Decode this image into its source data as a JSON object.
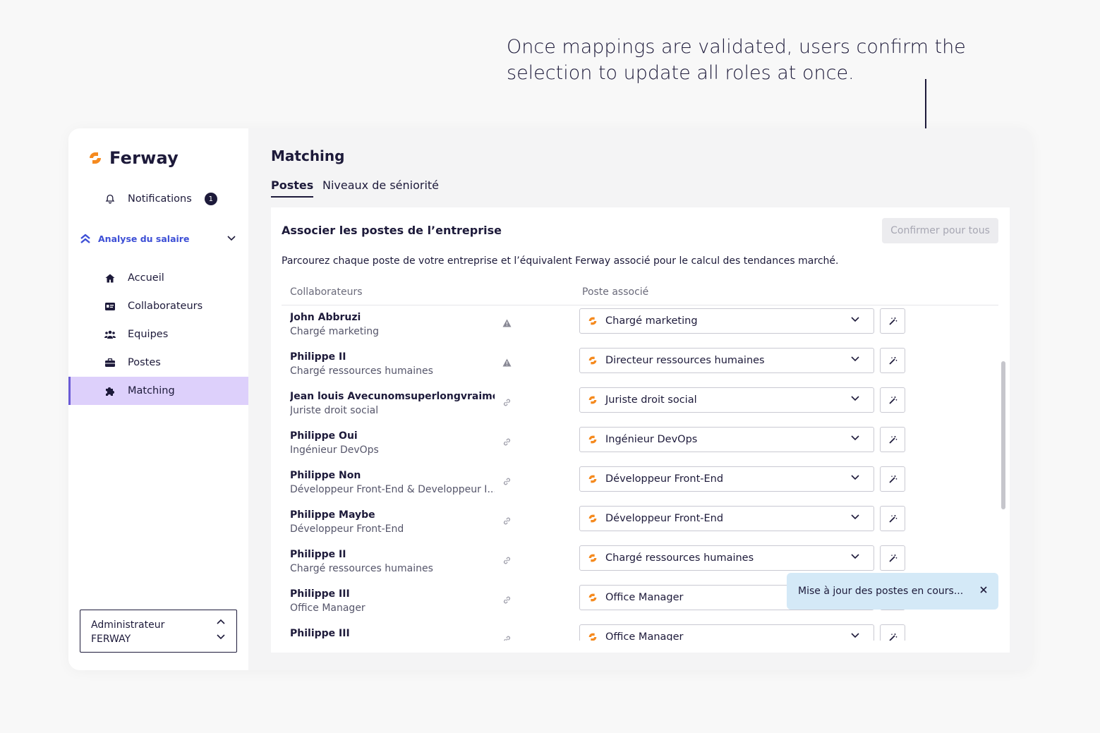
{
  "annotation": {
    "line1": "Once mappings are validated, users confirm the",
    "line2": "selection to update all roles at once."
  },
  "sidebar": {
    "brand": "Ferway",
    "notifications": {
      "label": "Notifications",
      "count": "1"
    },
    "section": {
      "label": "Analyse du salaire"
    },
    "items": [
      {
        "label": "Accueil",
        "icon": "home-icon"
      },
      {
        "label": "Collaborateurs",
        "icon": "id-card-icon"
      },
      {
        "label": "Equipes",
        "icon": "users-icon"
      },
      {
        "label": "Postes",
        "icon": "briefcase-icon"
      },
      {
        "label": "Matching",
        "icon": "puzzle-icon"
      }
    ],
    "account": {
      "line1": "Administrateur",
      "line2": "FERWAY"
    }
  },
  "main": {
    "title": "Matching",
    "tabs": [
      {
        "label": "Postes",
        "active": true
      },
      {
        "label": "Niveaux de séniorité",
        "active": false
      }
    ]
  },
  "card": {
    "title": "Associer les postes de l’entreprise",
    "confirm_label": "Confirmer pour tous",
    "description": "Parcourez chaque poste de votre entreprise et l’équivalent Ferway associé pour le calcul des tendances marché.",
    "col_collab": "Collaborateurs",
    "col_poste": "Poste associé",
    "rows": [
      {
        "name": "John Abbruzi",
        "role": "Chargé marketing",
        "status": "warning",
        "poste": "Chargé marketing"
      },
      {
        "name": "Philippe II",
        "role": "Chargé ressources humaines",
        "status": "warning",
        "poste": "Directeur ressources humaines"
      },
      {
        "name": "Jean louis Avecunomsuperlongvraime...",
        "role": "Juriste droit social",
        "status": "linked",
        "poste": "Juriste droit social"
      },
      {
        "name": "Philippe Oui",
        "role": "Ingénieur DevOps",
        "status": "linked",
        "poste": "Ingénieur DevOps"
      },
      {
        "name": "Philippe Non",
        "role": "Développeur Front-End & Developpeur I...",
        "status": "linked",
        "poste": "Développeur Front-End"
      },
      {
        "name": "Philippe Maybe",
        "role": "Développeur Front-End",
        "status": "linked",
        "poste": "Développeur Front-End"
      },
      {
        "name": "Philippe II",
        "role": "Chargé ressources humaines",
        "status": "linked",
        "poste": "Chargé ressources humaines"
      },
      {
        "name": "Philippe III",
        "role": "Office Manager",
        "status": "linked",
        "poste": "Office Manager"
      },
      {
        "name": "Philippe III",
        "role": "",
        "status": "linked",
        "poste": "Office Manager"
      }
    ]
  },
  "toast": {
    "message": "Mise à jour des postes en cours..."
  },
  "colors": {
    "brand_orange": "#f58a1f",
    "accent_blue": "#3d4fd6",
    "active_bg": "#ddd0fb",
    "toast_bg": "#d4e9f7"
  }
}
